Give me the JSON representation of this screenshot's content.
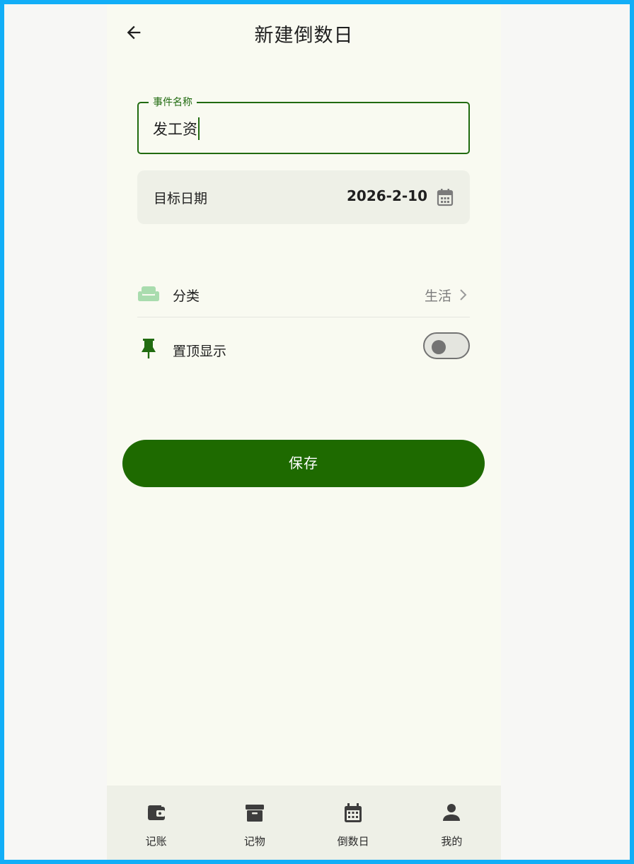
{
  "header": {
    "title": "新建倒数日",
    "back_icon": "arrow-left-icon"
  },
  "form": {
    "name_field": {
      "label": "事件名称",
      "value": "发工资"
    },
    "date_field": {
      "label": "目标日期",
      "value": "2026-2-10",
      "icon": "calendar-icon"
    },
    "category": {
      "label": "分类",
      "value": "生活",
      "icon": "sofa-icon"
    },
    "pin": {
      "label": "置顶显示",
      "enabled": false,
      "icon": "pin-icon"
    }
  },
  "save_button": {
    "label": "保存"
  },
  "bottom_nav": {
    "items": [
      {
        "label": "记账",
        "icon": "wallet-icon"
      },
      {
        "label": "记物",
        "icon": "archive-box-icon"
      },
      {
        "label": "倒数日",
        "icon": "calendar-icon"
      },
      {
        "label": "我的",
        "icon": "person-icon"
      }
    ]
  },
  "colors": {
    "accent": "#1e6a00",
    "background": "#f9faf1",
    "surface": "#eef0e7",
    "frame": "#12aef7",
    "category_icon": "#a9dcae"
  }
}
